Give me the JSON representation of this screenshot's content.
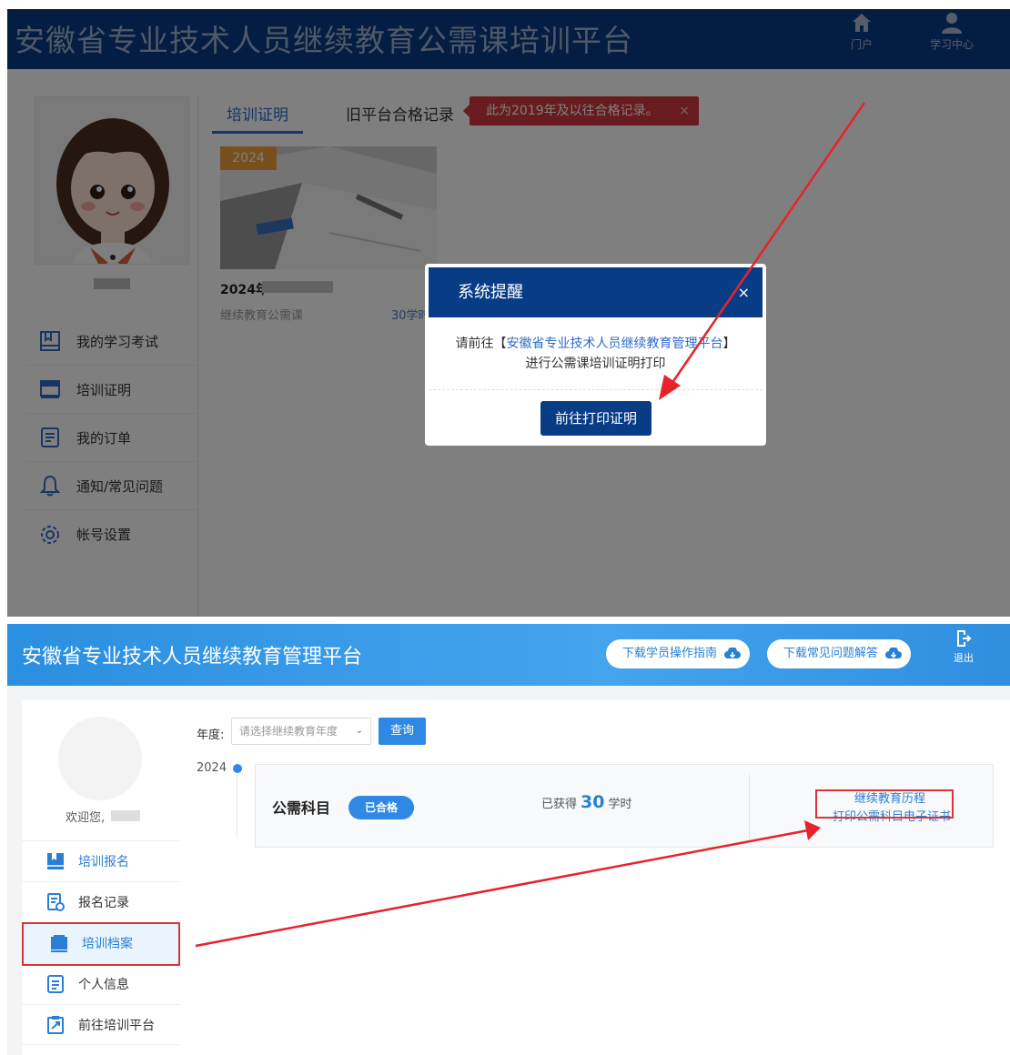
{
  "top": {
    "header": {
      "title": "安徽省专业技术人员继续教育公需课培训平台",
      "nav": [
        {
          "label": "门户",
          "icon": "home-icon"
        },
        {
          "label": "学习中心",
          "icon": "user-icon"
        }
      ],
      "color": "#083d86"
    },
    "sidebar": {
      "menu": [
        {
          "label": "我的学习考试",
          "icon": "book-icon"
        },
        {
          "label": "培训证明",
          "icon": "certificate-icon"
        },
        {
          "label": "我的订单",
          "icon": "order-icon"
        },
        {
          "label": "通知/常见问题",
          "icon": "bell-icon"
        },
        {
          "label": "帐号设置",
          "icon": "gear-icon"
        }
      ]
    },
    "tabs": {
      "active": "培训证明",
      "other": "旧平台合格记录",
      "notice": "此为2019年及以往合格记录。",
      "notice_close": "×"
    },
    "card": {
      "year_badge": "2024",
      "title": "2024年",
      "subtitle": "继续教育公需课",
      "hours": "30学时"
    },
    "modal": {
      "title": "系统提醒",
      "close": "×",
      "body_prefix": "请前往【",
      "body_link": "安徽省专业技术人员继续教育管理平台",
      "body_suffix": "】进行公需课培训证明打印",
      "button": "前往打印证明"
    }
  },
  "bottom": {
    "header": {
      "title": "安徽省专业技术人员继续教育管理平台",
      "guide_button": "下载学员操作指南",
      "faq_button": "下载常见问题解答",
      "logout": "退出",
      "color": "#2a8fe0"
    },
    "sidebar": {
      "welcome": "欢迎您,",
      "menu": [
        {
          "label": "培训报名",
          "icon": "register-icon"
        },
        {
          "label": "报名记录",
          "icon": "record-icon"
        },
        {
          "label": "培训档案",
          "icon": "archive-icon",
          "active": true
        },
        {
          "label": "个人信息",
          "icon": "profile-icon"
        },
        {
          "label": "前往培训平台",
          "icon": "external-icon"
        }
      ]
    },
    "filter": {
      "label": "年度:",
      "placeholder": "请选择继续教育年度",
      "chevron": "⌄",
      "query_button": "查询"
    },
    "record": {
      "year": "2024",
      "subject": "公需科目",
      "status": "已合格",
      "earned_prefix": "已获得",
      "earned_value": "30",
      "earned_unit": "学时",
      "link_history": "继续教育历程",
      "link_print": "打印公需科目电子证书"
    },
    "highlight_color": "#d9343a"
  }
}
